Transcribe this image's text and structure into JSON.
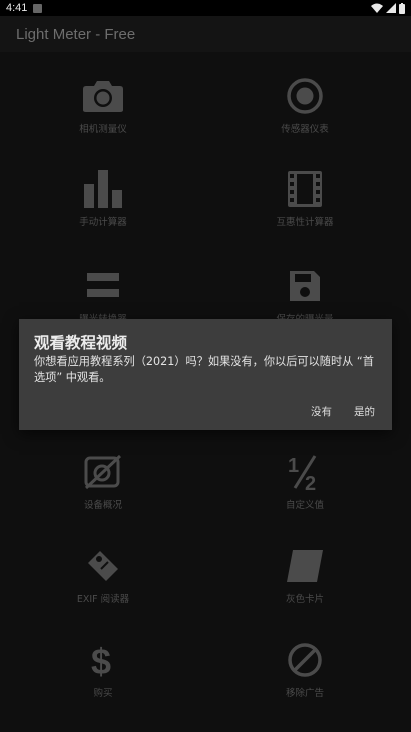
{
  "status_bar": {
    "time": "4:41"
  },
  "app_bar": {
    "title": "Light Meter - Free"
  },
  "menu": {
    "items": [
      {
        "label": "相机测量仪"
      },
      {
        "label": "传感器仪表"
      },
      {
        "label": "手动计算器"
      },
      {
        "label": "互惠性计算器"
      },
      {
        "label": "曝光转换器"
      },
      {
        "label": "保存的曝光量"
      },
      {
        "label": "设备概况"
      },
      {
        "label": "自定义值"
      },
      {
        "label": "EXIF 阅读器"
      },
      {
        "label": "灰色卡片"
      },
      {
        "label": "购买"
      },
      {
        "label": "移除广告"
      }
    ]
  },
  "dialog": {
    "title": "观看教程视频",
    "message": "你想看应用教程系列（2021）吗？如果没有，你以后可以随时从 “首选项” 中观看。",
    "no_label": "没有",
    "yes_label": "是的"
  },
  "colors": {
    "background": "#0f0f0f",
    "icon": "#4b4b4b",
    "dialog_bg": "#3d3d3d"
  }
}
